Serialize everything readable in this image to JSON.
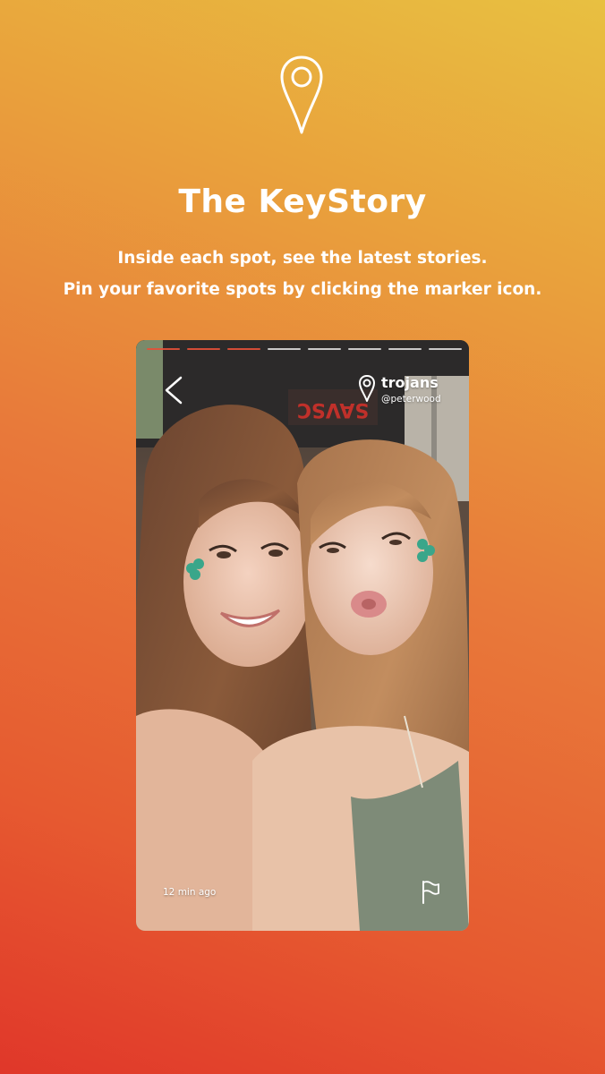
{
  "header": {
    "icon": "map-pin-icon",
    "title": "The KeyStory",
    "subtitle_line1": "Inside each spot, see the latest stories.",
    "subtitle_line2": "Pin your favorite spots by clicking the marker icon."
  },
  "story": {
    "spot_name": "trojans",
    "username": "@peterwood",
    "timestamp": "12 min ago",
    "progress": {
      "segments": 8,
      "viewed": 3
    },
    "photo_sign_text": "SAVSC",
    "icons": {
      "back": "chevron-left-icon",
      "pin": "map-pin-icon",
      "flag": "flag-icon"
    }
  },
  "colors": {
    "gradient_top": "#e8c041",
    "gradient_bottom": "#e0372a",
    "progress_viewed": "#e65037",
    "text": "#ffffff"
  }
}
